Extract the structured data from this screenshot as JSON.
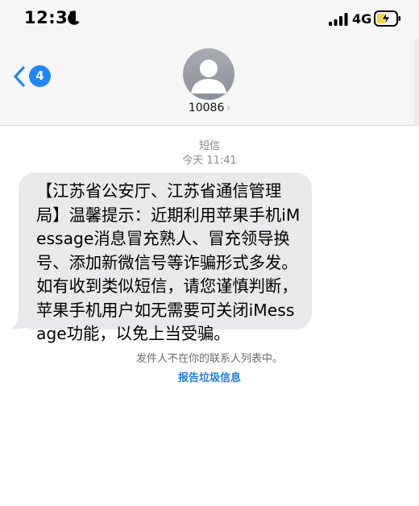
{
  "status_bar": {
    "time": "12:31",
    "network": "4G",
    "icons": [
      "moon-icon",
      "signal-icon",
      "battery-charging-icon"
    ]
  },
  "nav": {
    "back_badge": "4",
    "contact_name": "10086",
    "contact_chevron": "›",
    "icons": [
      "chevron-left-icon",
      "avatar-person-icon"
    ]
  },
  "thread": {
    "service_label": "短信",
    "timestamp_day": "今天",
    "timestamp_time": "11:41",
    "message_text": "【江苏省公安厅、江苏省通信管理局】温馨提示：近期利用苹果手机iMessage消息冒充熟人、冒充领导换号、添加新微信号等诈骗形式多发。如有收到类似短信，请您谨慎判断，苹果手机用户如无需要可关闭iMessage功能，以免上当受骗。",
    "sender_notice": "发件人不在你的联系人列表中。",
    "report_link": "报告垃圾信息"
  },
  "colors": {
    "accent": "#1f87f7",
    "bubble": "#e9e9eb",
    "header_bg": "#f6f6f6",
    "battery_charge": "#f5d547"
  }
}
